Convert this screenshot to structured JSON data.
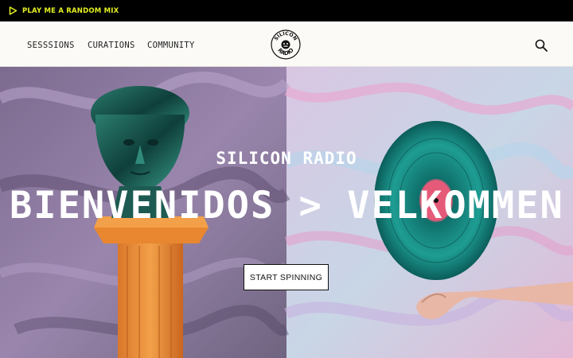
{
  "promo_bar": {
    "label": "PLAY ME A RANDOM MIX",
    "icon": "play-icon",
    "accent_color": "#e5f21f",
    "background": "#000000"
  },
  "nav": {
    "links": [
      {
        "label": "SESSSIONS"
      },
      {
        "label": "CURATIONS"
      },
      {
        "label": "COMMUNITY"
      }
    ],
    "logo": {
      "line1": "SILICON",
      "line2": "RADIO",
      "icon": "silicon-radio-logo"
    },
    "search_icon": "search-icon"
  },
  "hero": {
    "title": "SILICON RADIO",
    "marquee": "BIENVENIDOS > VELKOMMEN",
    "cta_label": "START SPINNING"
  }
}
